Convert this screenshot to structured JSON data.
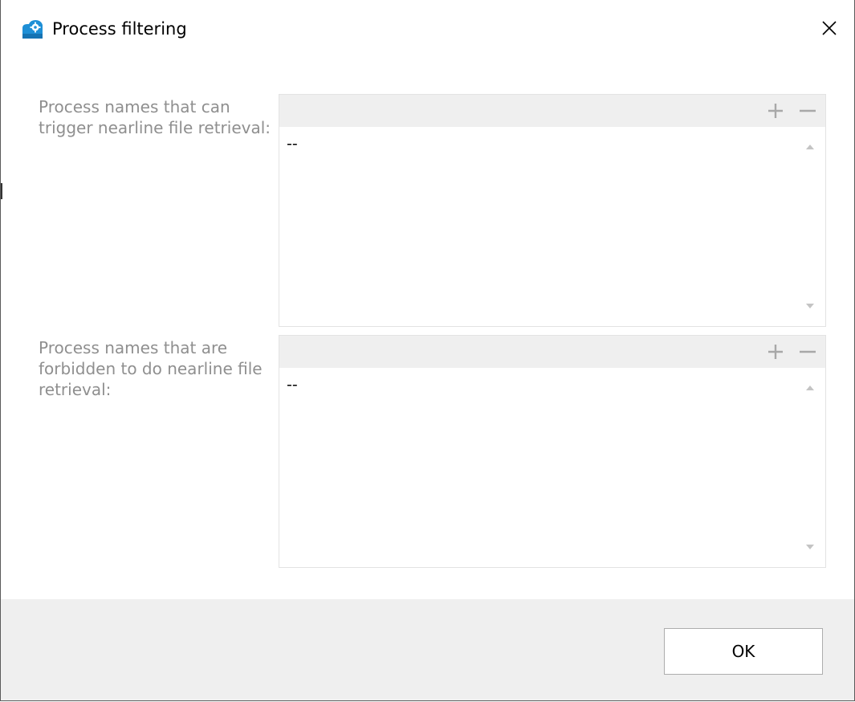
{
  "window": {
    "title": "Process filtering",
    "icon": "cloud-settings-icon"
  },
  "lists": [
    {
      "label": "Process names that can trigger nearline file retrieval:",
      "items": [
        "--"
      ],
      "add_icon": "plus-icon",
      "remove_icon": "minus-icon"
    },
    {
      "label": "Process names that are forbidden to do nearline file retrieval:",
      "items": [
        "--"
      ],
      "add_icon": "plus-icon",
      "remove_icon": "minus-icon"
    }
  ],
  "footer": {
    "ok_label": "OK"
  },
  "colors": {
    "accent": "#1e8fd6",
    "label_gray": "#8f8f8f",
    "header_bg": "#efefef",
    "footer_bg": "#efefef"
  }
}
